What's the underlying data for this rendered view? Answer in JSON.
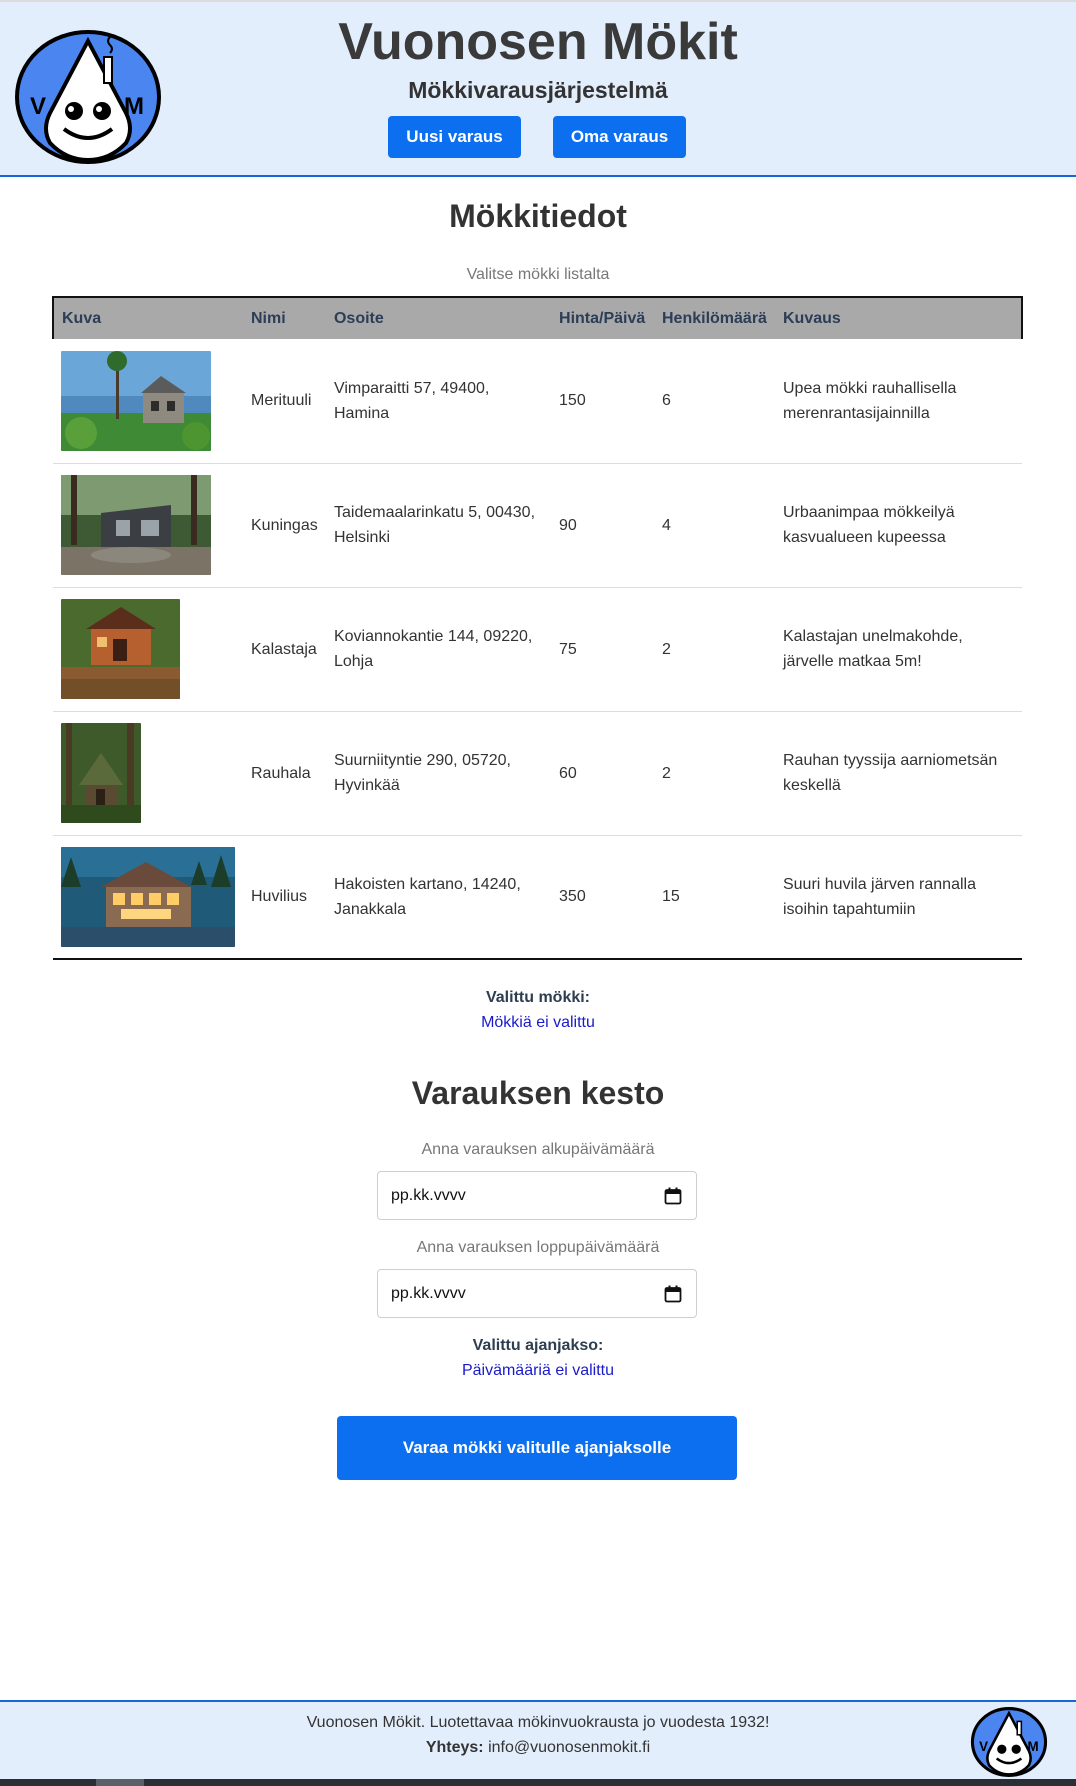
{
  "header": {
    "title": "Vuonosen Mökit",
    "subtitle": "Mökkivarausjärjestelmä",
    "logo_text_left": "V",
    "logo_text_right": "M",
    "nav": [
      {
        "label": "Uusi varaus"
      },
      {
        "label": "Oma varaus"
      }
    ]
  },
  "cabins": {
    "title": "Mökkitiedot",
    "hint": "Valitse mökki listalta",
    "columns": [
      "Kuva",
      "Nimi",
      "Osoite",
      "Hinta/Päivä",
      "Henkilömäärä",
      "Kuvaus"
    ],
    "rows": [
      {
        "image": "cabin-photo-merituuli",
        "name": "Merituuli",
        "address": "Vimparaitti 57, 49400, Hamina",
        "price": "150",
        "persons": "6",
        "description": "Upea mökki rauhallisella merenrantasijainnilla"
      },
      {
        "image": "cabin-photo-kuningas",
        "name": "Kuningas",
        "address": "Taidemaalarinkatu 5, 00430, Helsinki",
        "price": "90",
        "persons": "4",
        "description": "Urbaanimpaa mökkeilyä kasvualueen kupeessa"
      },
      {
        "image": "cabin-photo-kalastaja",
        "name": "Kalastaja",
        "address": "Koviannokantie 144, 09220, Lohja",
        "price": "75",
        "persons": "2",
        "description": "Kalastajan unelmakohde, järvelle matkaa 5m!"
      },
      {
        "image": "cabin-photo-rauhala",
        "name": "Rauhala",
        "address": "Suurniityntie 290, 05720, Hyvinkää",
        "price": "60",
        "persons": "2",
        "description": "Rauhan tyyssija aarniometsän keskellä"
      },
      {
        "image": "cabin-photo-huvilius",
        "name": "Huvilius",
        "address": "Hakoisten kartano, 14240, Janakkala",
        "price": "350",
        "persons": "15",
        "description": "Suuri huvila järven rannalla isoihin tapahtumiin"
      }
    ],
    "selected_label": "Valittu mökki:",
    "selected_value": "Mökkiä ei valittu"
  },
  "booking": {
    "title": "Varauksen kesto",
    "start_label": "Anna varauksen alkupäivämäärä",
    "start_placeholder": "pp.kk.vvvv",
    "end_label": "Anna varauksen loppupäivämäärä",
    "end_placeholder": "pp.kk.vvvv",
    "period_label": "Valittu ajanjakso:",
    "period_value": "Päivämääriä ei valittu",
    "submit_label": "Varaa mökki valitulle ajanjaksolle"
  },
  "footer": {
    "tagline": "Vuonosen Mökit. Luotettavaa mökinvuokrausta jo vuodesta 1932!",
    "contact_label": "Yhteys:",
    "contact_email": "info@vuonosenmokit.fi"
  },
  "colors": {
    "accent": "#0b6ff0",
    "header_bg": "#e3eefc",
    "link": "#1a1acb"
  }
}
